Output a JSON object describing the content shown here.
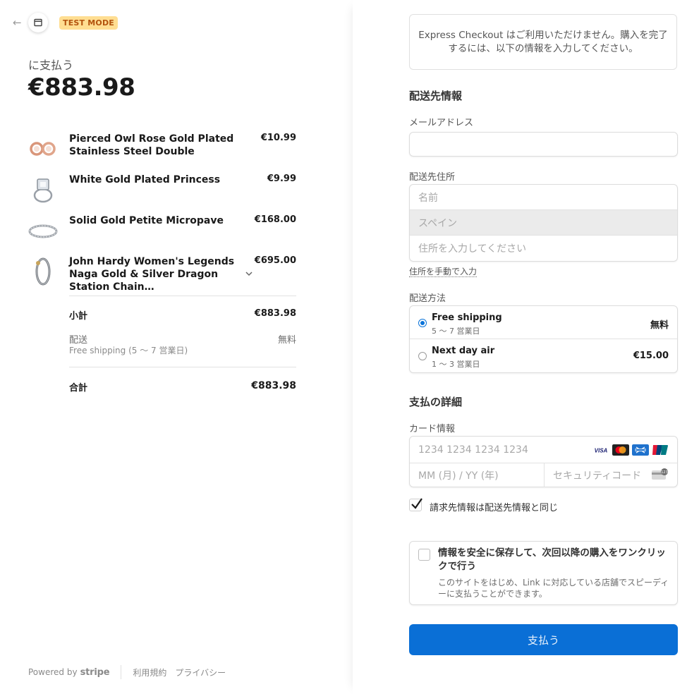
{
  "header": {
    "test_mode": "TEST MODE"
  },
  "summary": {
    "pay_label": "に支払う",
    "amount": "€883.98",
    "items": [
      {
        "name": "Pierced Owl Rose Gold Plated Stainless Steel Double",
        "price": "€10.99",
        "icon": "rose-gold-earrings-icon"
      },
      {
        "name": "White Gold Plated Princess",
        "price": "€9.99",
        "icon": "princess-ring-icon"
      },
      {
        "name": "Solid Gold Petite Micropave",
        "price": "€168.00",
        "icon": "micropave-band-icon"
      },
      {
        "name": "John Hardy Women's Legends Naga Gold & Silver Dragon Station Chain…",
        "price": "€695.00",
        "icon": "dragon-bracelet-icon"
      }
    ],
    "subtotal_label": "小計",
    "subtotal": "€883.98",
    "shipping_label": "配送",
    "shipping_value": "無料",
    "shipping_sub": "Free shipping (5 〜 7 営業日)",
    "total_label": "合計",
    "total": "€883.98"
  },
  "footer": {
    "powered_by": "Powered by",
    "brand": "stripe",
    "terms": "利用規約",
    "privacy": "プライバシー"
  },
  "express": {
    "message": "Express Checkout はご利用いただけません。購入を完了するには、以下の情報を入力してください。"
  },
  "shipping_info": {
    "title": "配送先情報",
    "email_label": "メールアドレス",
    "email_value": "",
    "address_label": "配送先住所",
    "name_placeholder": "名前",
    "country": "スペイン",
    "address_placeholder": "住所を入力してください",
    "manual_link": "住所を手動で入力"
  },
  "shipping_method": {
    "title": "配送方法",
    "options": [
      {
        "name": "Free shipping",
        "sub": "5 〜 7 営業日",
        "price": "無料",
        "selected": true
      },
      {
        "name": "Next day air",
        "sub": "1 〜 3 営業日",
        "price": "€15.00",
        "selected": false
      }
    ]
  },
  "payment": {
    "title": "支払の詳細",
    "card_label": "カード情報",
    "card_placeholder": "1234 1234 1234 1234",
    "expiry_placeholder": "MM (月) / YY (年)",
    "cvc_placeholder": "セキュリティコード",
    "brands": [
      "visa-icon",
      "mastercard-icon",
      "amex-icon",
      "unionpay-icon"
    ],
    "billing_same": "請求先情報は配送先情報と同じ",
    "billing_same_checked": true
  },
  "link": {
    "title": "情報を安全に保存して、次回以降の購入をワンクリックで行う",
    "description": "このサイトをはじめ、Link に対応している店舗でスピーディーに支払うことができます。"
  },
  "pay_button": "支払う",
  "colors": {
    "accent": "#0a6fd6",
    "test_mode_bg": "#ffde92",
    "test_mode_text": "#b3530d"
  }
}
